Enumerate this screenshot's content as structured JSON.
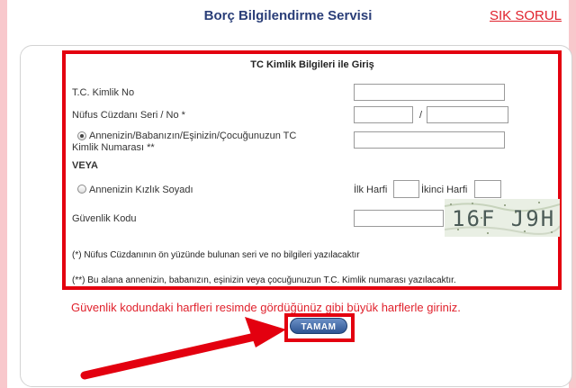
{
  "header": {
    "title": "Borç Bilgilendirme Servisi",
    "faq_link": "SIK SORUL"
  },
  "form": {
    "heading": "TC Kimlik Bilgileri ile Giriş",
    "tc_label": "T.C. Kimlik No",
    "tc_value": "",
    "nufus_label": "Nüfus Cüzdanı Seri / No *",
    "nufus_serial_value": "",
    "nufus_slash": "/",
    "nufus_number_value": "",
    "option_relative_label_line1": "Annenizin/Babanızın/Eşinizin/Çocuğunuzun TC",
    "option_relative_label_line2": "Kimlik Numarası **",
    "option_relative_selected": true,
    "option_relative_value": "",
    "or_label": "VEYA",
    "option_maiden_label": "Annenizin Kızlık Soyadı",
    "option_maiden_selected": false,
    "first_letter_label": "İlk Harfi",
    "first_letter_value": "",
    "second_letter_label": "İkinci Harfi",
    "second_letter_value": "",
    "security_label": "Güvenlik Kodu",
    "security_value": "",
    "captcha_text": "16F J9H",
    "note_1": "(*) Nüfus Cüzdanının ön yüzünde bulunan seri ve no bilgileri yazılacaktır",
    "note_2": "(**) Bu alana annenizin, babanızın, eşinizin veya çocuğunuzun T.C. Kimlik numarası yazılacaktır.",
    "warning": "Güvenlik kodundaki harfleri resimde gördüğünüz gibi büyük harflerle giriniz.",
    "submit_label": "TAMAM"
  },
  "colors": {
    "accent_red": "#e3000f",
    "title_blue": "#2a3e78",
    "button_blue": "#2e5593",
    "page_background": "#f8c8cc"
  }
}
